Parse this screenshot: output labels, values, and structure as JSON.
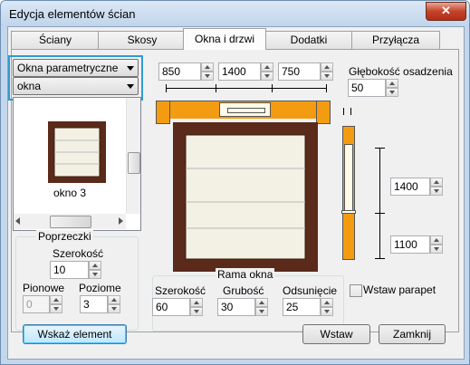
{
  "window": {
    "title": "Edycja elementów ścian",
    "close_glyph": "✕"
  },
  "tabs": [
    {
      "label": "Ściany"
    },
    {
      "label": "Skosy"
    },
    {
      "label": "Okna i drzwi",
      "active": true
    },
    {
      "label": "Dodatki"
    },
    {
      "label": "Przyłącza"
    }
  ],
  "selectors": {
    "category": "Okna parametryczne",
    "type": "okna"
  },
  "preview": {
    "item_label": "okno 3"
  },
  "dims_top": {
    "left": "850",
    "middle": "1400",
    "right": "750"
  },
  "depth": {
    "label": "Głębokość osadzenia",
    "value": "50"
  },
  "side_dims": {
    "top": "1400",
    "bottom": "1100"
  },
  "crossbars": {
    "group_label": "Poprzeczki",
    "width_label": "Szerokość",
    "width_value": "10",
    "vertical_label": "Pionowe",
    "vertical_value": "0",
    "horizontal_label": "Poziome",
    "horizontal_value": "3"
  },
  "frame": {
    "group_label": "Rama okna",
    "width_label": "Szerokość",
    "width_value": "60",
    "thickness_label": "Grubość",
    "thickness_value": "30",
    "offset_label": "Odsunięcie",
    "offset_value": "25"
  },
  "parapet": {
    "label": "Wstaw parapet",
    "checked": false
  },
  "buttons": {
    "show": "Wskaż element",
    "insert": "Wstaw",
    "close": "Zamknij"
  },
  "colors": {
    "accent": "#2f9ad6",
    "wall": "#f39c12",
    "frame": "#5a2a1a",
    "glass": "#f3f1e4"
  }
}
